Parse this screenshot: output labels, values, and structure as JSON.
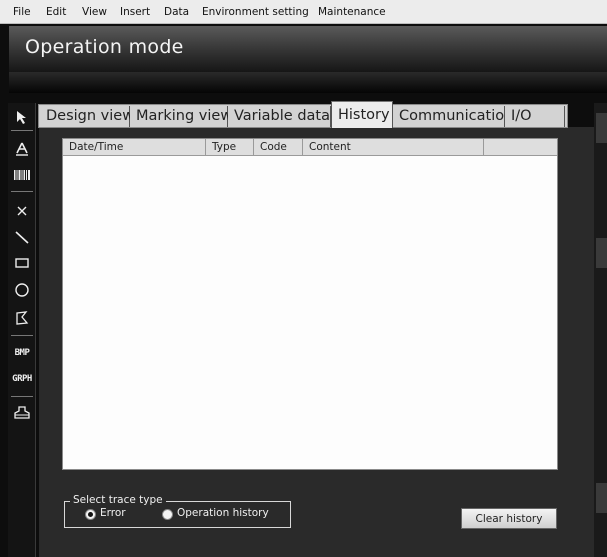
{
  "menubar": {
    "items": [
      "File",
      "Edit",
      "View",
      "Insert",
      "Data",
      "Environment setting",
      "Maintenance"
    ]
  },
  "title": "Operation mode",
  "tools": [
    {
      "icon": "pointer-icon"
    },
    {
      "icon": "text-icon"
    },
    {
      "icon": "barcode-icon"
    },
    {
      "icon": "cross-mark-icon"
    },
    {
      "icon": "line-icon"
    },
    {
      "icon": "rectangle-icon"
    },
    {
      "icon": "circle-icon"
    },
    {
      "icon": "polygon-icon"
    },
    {
      "icon": "bmp-icon",
      "label": "BMP"
    },
    {
      "icon": "graph-icon",
      "label": "GRPH"
    },
    {
      "icon": "stamp-icon"
    }
  ],
  "tabs": [
    {
      "label": "Design view"
    },
    {
      "label": "Marking view"
    },
    {
      "label": "Variable data"
    },
    {
      "label": "History",
      "active": true
    },
    {
      "label": "Communication"
    },
    {
      "label": "I/O"
    }
  ],
  "history_list": {
    "columns": [
      "Date/Time",
      "Type",
      "Code",
      "Content"
    ],
    "rows": []
  },
  "trace_type": {
    "group_label": "Select trace type",
    "options": [
      {
        "label": "Error",
        "selected": true
      },
      {
        "label": "Operation history",
        "selected": false
      }
    ]
  },
  "clear_button": "Clear history"
}
